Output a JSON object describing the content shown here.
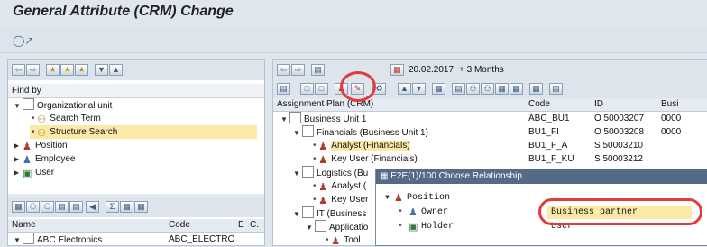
{
  "window": {
    "title": "General Attribute (CRM) Change",
    "subtitle_icon": "glasses-icon"
  },
  "left_panel": {
    "find_by_label": "Find by",
    "tree": [
      {
        "label": "Organizational unit",
        "icon": "folder-icon",
        "expanded": true
      },
      {
        "label": "Search Term",
        "icon": "binoculars-icon"
      },
      {
        "label": "Structure Search",
        "icon": "binoculars-icon",
        "selected": true
      },
      {
        "label": "Position",
        "icon": "person-icon"
      },
      {
        "label": "Employee",
        "icon": "people-icon"
      },
      {
        "label": "User",
        "icon": "user-icon"
      }
    ],
    "bottom_table": {
      "headers": [
        "Name",
        "Code",
        "E",
        "C."
      ],
      "rows": [
        {
          "name": "ABC Electronics",
          "code": "ABC_ELECTRO"
        }
      ]
    }
  },
  "right_panel": {
    "date_label": "20.02.2017",
    "period_label": "+ 3 Months",
    "headers": {
      "plan": "Assignment Plan (CRM)",
      "code": "Code",
      "id": "ID",
      "busi": "Busi"
    },
    "rows": [
      {
        "label": "Business Unit 1",
        "code": "ABC_BU1",
        "id": "O 50003207",
        "busi": "0000"
      },
      {
        "label": "Financials (Business Unit 1)",
        "code": "BU1_FI",
        "id": "O 50003208",
        "busi": "0000"
      },
      {
        "label": "Analyst (Financials)",
        "code": "BU1_F_A",
        "id": "S 50003210",
        "busi": ""
      },
      {
        "label": "Key User (Financials)",
        "code": "BU1_F_KU",
        "id": "S 50003212",
        "busi": ""
      },
      {
        "label": "Logistics (Bu",
        "code": "",
        "id": "",
        "busi": ""
      },
      {
        "label": "Analyst (",
        "code": "",
        "id": "",
        "busi": ""
      },
      {
        "label": "Key User",
        "code": "",
        "id": "",
        "busi": ""
      },
      {
        "label": "IT (Business",
        "code": "",
        "id": "",
        "busi": ""
      },
      {
        "label": "Applicatio",
        "code": "",
        "id": "",
        "busi": ""
      },
      {
        "label": "Tool",
        "code": "",
        "id": "",
        "busi": ""
      }
    ]
  },
  "popup": {
    "title": "E2E(1)/100 Choose Relationship",
    "root": "Position",
    "items": [
      {
        "label": "Owner",
        "value": "Business partner",
        "icon": "people-icon"
      },
      {
        "label": "Holder",
        "value": "User",
        "icon": "user-icon"
      }
    ]
  },
  "colors": {
    "highlight_circle": "#e23b3b",
    "selected_row": "#fde9a6"
  }
}
